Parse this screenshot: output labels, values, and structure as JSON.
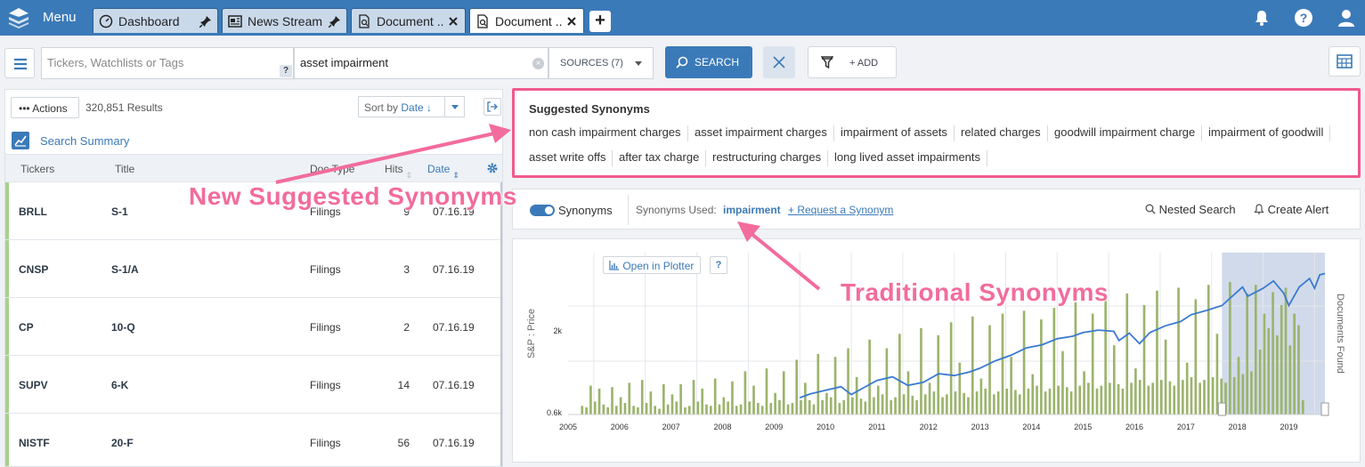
{
  "topbar": {
    "menu_label": "Menu",
    "tabs": [
      {
        "label": "Dashboard",
        "icon": "dashboard-icon",
        "action": "pin-icon",
        "active": false
      },
      {
        "label": "News Stream",
        "icon": "news-icon",
        "action": "pin-icon",
        "active": false
      },
      {
        "label": "Document ...",
        "icon": "document-search-icon",
        "action": "close-icon",
        "active": false
      },
      {
        "label": "Document ...",
        "icon": "document-search-icon",
        "action": "close-icon",
        "active": true
      }
    ],
    "add_tab": "+"
  },
  "toolbar": {
    "ticker_placeholder": "Tickers, Watchlists or Tags",
    "ticker_help": "?",
    "query_value": "asset impairment",
    "clear": "×",
    "sources_label": "SOURCES (7)",
    "search_label": "SEARCH",
    "add_label": "+ ADD"
  },
  "results": {
    "actions_label": "••• Actions",
    "count": "320,851 Results",
    "sort_prefix": "Sort by",
    "sort_value": "Date ↓",
    "summary_label": "Search Summary",
    "columns": {
      "ticker": "Tickers",
      "title": "Title",
      "doctype": "Doc Type",
      "hits": "Hits",
      "date": "Date"
    },
    "rows": [
      {
        "ticker": "BRLL",
        "title": "S-1",
        "doctype": "Filings",
        "hits": "9",
        "date": "07.16.19"
      },
      {
        "ticker": "CNSP",
        "title": "S-1/A",
        "doctype": "Filings",
        "hits": "3",
        "date": "07.16.19"
      },
      {
        "ticker": "CP",
        "title": "10-Q",
        "doctype": "Filings",
        "hits": "2",
        "date": "07.16.19"
      },
      {
        "ticker": "SUPV",
        "title": "6-K",
        "doctype": "Filings",
        "hits": "14",
        "date": "07.16.19"
      },
      {
        "ticker": "NISTF",
        "title": "20-F",
        "doctype": "Filings",
        "hits": "56",
        "date": "07.16.19"
      }
    ]
  },
  "synonyms": {
    "title": "Suggested Synonyms",
    "chips": [
      "non cash impairment charges",
      "asset impairment charges",
      "impairment of assets",
      "related charges",
      "goodwill impairment charge",
      "impairment of goodwill",
      "asset write offs",
      "after tax charge",
      "restructuring charges",
      "long lived asset impairments"
    ],
    "toggle_label": "Synonyms",
    "used_label": "Synonyms Used:",
    "used_value": "impairment",
    "request_link": "+ Request a Synonym",
    "nested_search": "Nested Search",
    "create_alert": "Create Alert"
  },
  "chart": {
    "plotter_label": "Open in Plotter",
    "help": "?"
  },
  "chart_data": {
    "type": "bar",
    "ylabel": "S&P : Price",
    "y2label": "Documents Found",
    "yticks": [
      "2k",
      "0.6k"
    ],
    "x_ticks": [
      "2005",
      "2006",
      "2007",
      "2008",
      "2009",
      "2010",
      "2011",
      "2012",
      "2013",
      "2014",
      "2015",
      "2016",
      "2017",
      "2018",
      "2019"
    ],
    "xlim": [
      2005,
      2019.7
    ],
    "bars_start": 2005.25,
    "bars_per_year": 12,
    "selected_range": [
      2017.7,
      2019.7
    ],
    "series": [
      {
        "name": "Documents Found",
        "kind": "bar",
        "values": [
          6,
          5,
          20,
          9,
          18,
          7,
          5,
          19,
          6,
          12,
          8,
          22,
          6,
          5,
          24,
          8,
          16,
          6,
          4,
          21,
          7,
          14,
          9,
          21,
          5,
          6,
          24,
          9,
          18,
          7,
          6,
          25,
          7,
          12,
          9,
          23,
          6,
          7,
          30,
          9,
          20,
          8,
          6,
          32,
          8,
          15,
          10,
          30,
          7,
          8,
          38,
          10,
          22,
          10,
          7,
          42,
          10,
          15,
          12,
          40,
          8,
          10,
          46,
          12,
          26,
          11,
          9,
          52,
          12,
          20,
          14,
          46,
          10,
          12,
          56,
          14,
          30,
          13,
          10,
          60,
          14,
          22,
          16,
          55,
          12,
          14,
          64,
          16,
          36,
          15,
          12,
          68,
          16,
          25,
          18,
          62,
          14,
          16,
          70,
          18,
          40,
          17,
          14,
          72,
          18,
          28,
          20,
          66,
          16,
          18,
          74,
          20,
          44,
          19,
          16,
          78,
          20,
          30,
          22,
          70,
          18,
          20,
          80,
          22,
          48,
          21,
          18,
          84,
          22,
          32,
          24,
          76,
          20,
          22,
          86,
          24,
          52,
          23,
          20,
          88,
          24,
          36,
          26,
          80,
          22,
          24,
          90,
          26,
          56,
          25,
          22,
          92,
          26,
          40,
          28,
          84,
          30,
          90,
          45,
          70,
          60,
          85,
          55,
          76,
          88,
          48,
          70,
          62,
          10
        ]
      },
      {
        "name": "S&P Price",
        "kind": "line",
        "points": [
          [
            2009.5,
            1000
          ],
          [
            2009.7,
            1060
          ],
          [
            2010.0,
            1120
          ],
          [
            2010.3,
            1180
          ],
          [
            2010.5,
            1050
          ],
          [
            2010.8,
            1190
          ],
          [
            2011.0,
            1280
          ],
          [
            2011.3,
            1340
          ],
          [
            2011.6,
            1200
          ],
          [
            2011.9,
            1250
          ],
          [
            2012.2,
            1390
          ],
          [
            2012.5,
            1360
          ],
          [
            2012.8,
            1420
          ],
          [
            2013.0,
            1480
          ],
          [
            2013.3,
            1600
          ],
          [
            2013.6,
            1690
          ],
          [
            2013.9,
            1810
          ],
          [
            2014.2,
            1860
          ],
          [
            2014.5,
            1960
          ],
          [
            2014.8,
            2000
          ],
          [
            2015.0,
            2060
          ],
          [
            2015.3,
            2100
          ],
          [
            2015.6,
            2080
          ],
          [
            2015.7,
            1930
          ],
          [
            2015.9,
            2050
          ],
          [
            2016.1,
            1880
          ],
          [
            2016.3,
            2060
          ],
          [
            2016.6,
            2170
          ],
          [
            2016.9,
            2240
          ],
          [
            2017.1,
            2350
          ],
          [
            2017.4,
            2420
          ],
          [
            2017.7,
            2500
          ],
          [
            2017.9,
            2650
          ],
          [
            2018.1,
            2800
          ],
          [
            2018.2,
            2650
          ],
          [
            2018.5,
            2780
          ],
          [
            2018.7,
            2900
          ],
          [
            2018.9,
            2700
          ],
          [
            2019.0,
            2500
          ],
          [
            2019.2,
            2800
          ],
          [
            2019.4,
            2940
          ],
          [
            2019.5,
            2780
          ],
          [
            2019.6,
            3000
          ],
          [
            2019.7,
            3020
          ]
        ]
      }
    ]
  },
  "annotations": {
    "new_synonyms": "New Suggested Synonyms",
    "traditional": "Traditional Synonyms"
  },
  "colors": {
    "accent": "#3b7ab8",
    "annotation": "#f26c9c",
    "bar": "#9bb46c",
    "line": "#3b7ad0",
    "flag": "#a8d18c"
  }
}
